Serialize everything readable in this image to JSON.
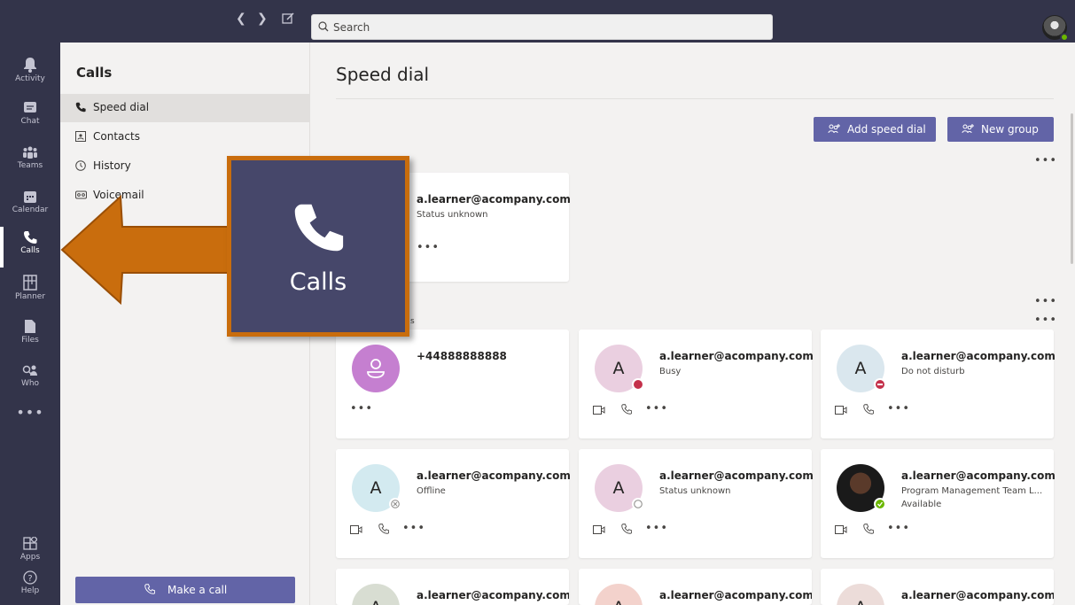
{
  "search": {
    "placeholder": "Search"
  },
  "rail": {
    "items": [
      {
        "label": "Activity"
      },
      {
        "label": "Chat"
      },
      {
        "label": "Teams"
      },
      {
        "label": "Calendar"
      },
      {
        "label": "Calls"
      },
      {
        "label": "Planner"
      },
      {
        "label": "Files"
      },
      {
        "label": "Who"
      },
      {
        "label": "..."
      },
      {
        "label": "Apps"
      },
      {
        "label": "Help"
      }
    ]
  },
  "panel": {
    "title": "Calls",
    "items": [
      {
        "label": "Speed dial"
      },
      {
        "label": "Contacts"
      },
      {
        "label": "History"
      },
      {
        "label": "Voicemail"
      }
    ],
    "make_call": "Make a call"
  },
  "main": {
    "title": "Speed dial",
    "add_speed_dial": "Add speed dial",
    "new_group": "New group"
  },
  "overlay": {
    "label": "Calls"
  },
  "section_partial": "s",
  "cards": [
    {
      "name": "a.learner@acompany.com",
      "status": "Status unknown"
    },
    {
      "name": "+44888888888",
      "status": ""
    },
    {
      "name": "a.learner@acompany.com",
      "status": "Busy",
      "initial": "A"
    },
    {
      "name": "a.learner@acompany.com",
      "status": "Do not disturb",
      "initial": "A"
    },
    {
      "name": "a.learner@acompany.com",
      "status": "Offline",
      "initial": "A"
    },
    {
      "name": "a.learner@acompany.com",
      "status": "Status unknown",
      "initial": "A"
    },
    {
      "name": "a.learner@acompany.com",
      "status": "Program Management Team L...",
      "status2": "Available"
    },
    {
      "name": "a.learner@acompany.com",
      "initial": "A"
    },
    {
      "name": "a.learner@acompany.com",
      "initial": "A"
    },
    {
      "name": "a.learner@acompany.com",
      "initial": "A"
    }
  ],
  "colors": {
    "rail": "#33344a",
    "accent": "#6264a7",
    "highlight": "#c96d0d",
    "busy": "#c4314b",
    "available": "#6bb700"
  },
  "dots": "•••"
}
